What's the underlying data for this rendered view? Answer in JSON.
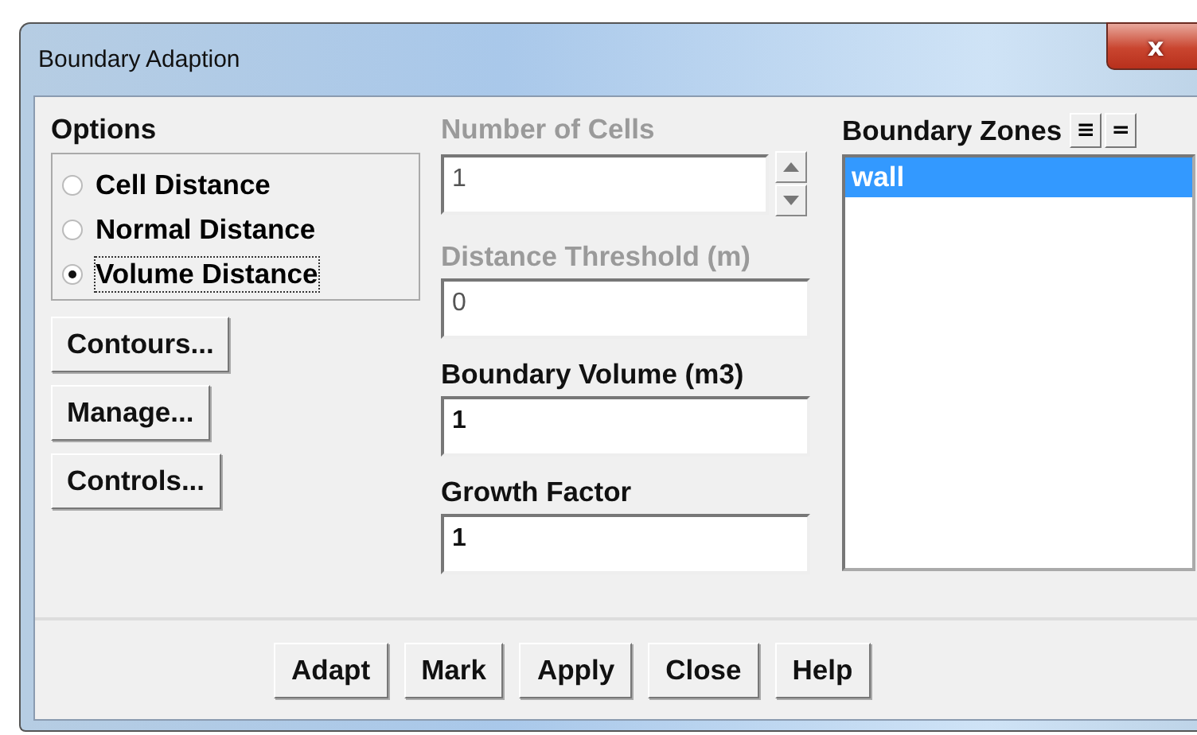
{
  "window": {
    "title": "Boundary Adaption",
    "close": "x"
  },
  "options": {
    "title": "Options",
    "radios": [
      {
        "label": "Cell Distance",
        "selected": false
      },
      {
        "label": "Normal Distance",
        "selected": false
      },
      {
        "label": "Volume Distance",
        "selected": true
      }
    ]
  },
  "side_buttons": [
    "Contours...",
    "Manage...",
    "Controls..."
  ],
  "fields": [
    {
      "label": "Number of Cells",
      "value": "1",
      "disabled": true,
      "spinner": true
    },
    {
      "label": "Distance Threshold (m)",
      "value": "0",
      "disabled": true,
      "spinner": false
    },
    {
      "label": "Boundary Volume (m3)",
      "value": "1",
      "disabled": false,
      "spinner": false
    },
    {
      "label": "Growth Factor",
      "value": "1",
      "disabled": false,
      "spinner": false
    }
  ],
  "zones": {
    "title": "Boundary Zones",
    "select_all": "≡",
    "deselect_all": "=",
    "items": [
      {
        "label": "wall",
        "selected": true
      }
    ]
  },
  "buttons": [
    "Adapt",
    "Mark",
    "Apply",
    "Close",
    "Help"
  ]
}
